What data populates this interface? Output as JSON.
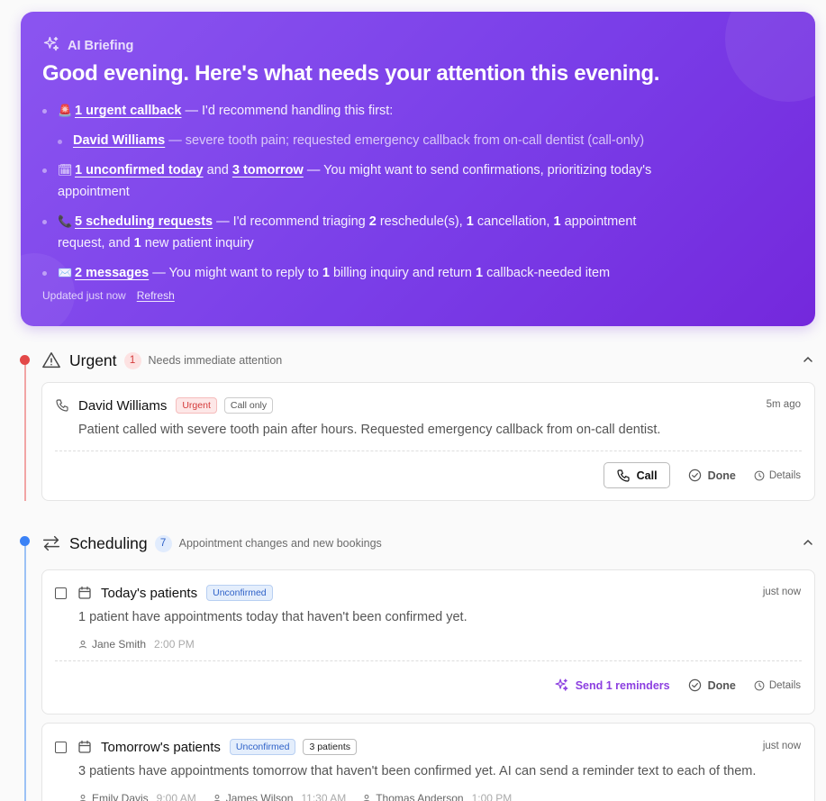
{
  "briefing": {
    "label": "AI Briefing",
    "title": "Good evening. Here's what needs your attention this evening.",
    "items": [
      {
        "emoji": "🚨",
        "link": "1 urgent callback",
        "text": " — I'd recommend handling this first:",
        "sub": {
          "link": "David Williams",
          "text": " — severe tooth pain; requested emergency callback from on-call dentist (call-only)"
        }
      },
      {
        "emoji": "🗓",
        "link": "1 unconfirmed today",
        "mid": " and ",
        "link2": "3 tomorrow",
        "text": " — You might want to send confirmations, prioritizing today's appointment"
      },
      {
        "emoji": "📞",
        "link": "5 scheduling requests",
        "t1": " — I'd recommend triaging ",
        "n1": "2",
        "t2": " reschedule(s), ",
        "n2": "1",
        "t3": " cancellation, ",
        "n3": "1",
        "t4": " appointment request, and ",
        "n4": "1",
        "t5": " new patient inquiry"
      },
      {
        "emoji": "✉️",
        "link": "2 messages",
        "t1": " — You might want to reply to ",
        "n1": "1",
        "t2": " billing inquiry and return ",
        "n2": "1",
        "t3": " callback-needed item"
      }
    ],
    "updated": "Updated just now",
    "refresh": "Refresh"
  },
  "sections": {
    "urgent": {
      "title": "Urgent",
      "count": "1",
      "subtitle": "Needs immediate attention",
      "color": "#e34848",
      "card": {
        "name": "David Williams",
        "badge1": "Urgent",
        "badge2": "Call only",
        "time": "5m ago",
        "desc": "Patient called with severe tooth pain after hours. Requested emergency callback from on-call dentist.",
        "call": "Call",
        "done": "Done",
        "details": "Details"
      }
    },
    "scheduling": {
      "title": "Scheduling",
      "count": "7",
      "subtitle": "Appointment changes and new bookings",
      "color": "#3b82f6",
      "cards": [
        {
          "title": "Today's patients",
          "badge": "Unconfirmed",
          "time": "just now",
          "desc": "1 patient have appointments today that haven't been confirmed yet.",
          "people": [
            {
              "name": "Jane Smith",
              "time": "2:00 PM"
            }
          ],
          "ai_action": "Send 1 reminders",
          "done": "Done",
          "details": "Details"
        },
        {
          "title": "Tomorrow's patients",
          "badge": "Unconfirmed",
          "badge2": "3 patients",
          "time": "just now",
          "desc": "3 patients have appointments tomorrow that haven't been confirmed yet. AI can send a reminder text to each of them.",
          "people": [
            {
              "name": "Emily Davis",
              "time": "9:00 AM"
            },
            {
              "name": "James Wilson",
              "time": "11:30 AM"
            },
            {
              "name": "Thomas Anderson",
              "time": "1:00 PM"
            }
          ]
        }
      ]
    }
  }
}
